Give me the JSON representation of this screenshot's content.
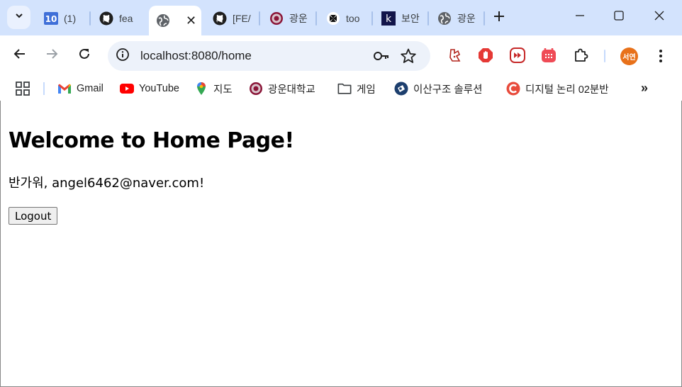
{
  "tabs": [
    {
      "label": "(1)",
      "icon": "tab-10-icon"
    },
    {
      "label": "fea",
      "icon": "github-icon"
    },
    {
      "label": "",
      "icon": "globe-icon",
      "active": true
    },
    {
      "label": "[FE/",
      "icon": "github-icon"
    },
    {
      "label": "광운",
      "icon": "kwu-emblem-icon"
    },
    {
      "label": "too",
      "icon": "tool-icon"
    },
    {
      "label": "보안",
      "icon": "k-icon"
    },
    {
      "label": "광운",
      "icon": "globe-icon"
    }
  ],
  "toolbar": {
    "url": "localhost:8080/home",
    "profile_label": "서연"
  },
  "bookmarks": [
    {
      "label": "Gmail",
      "icon": "gmail-icon"
    },
    {
      "label": "YouTube",
      "icon": "youtube-icon"
    },
    {
      "label": "지도",
      "icon": "maps-pin-icon"
    },
    {
      "label": "광운대학교",
      "icon": "kwu-emblem-icon"
    },
    {
      "label": "게임",
      "icon": "folder-icon"
    },
    {
      "label": "이산구조 솔루션",
      "icon": "discrete-icon"
    },
    {
      "label": "디지털 논리 02분반",
      "icon": "c-circle-icon"
    }
  ],
  "page": {
    "heading": "Welcome to Home Page!",
    "greeting": "반가워, angel6462@naver.com!",
    "logout_label": "Logout"
  },
  "colors": {
    "tabstrip_bg": "#d3e3fd",
    "omnibox_bg": "#edf2fa",
    "avatar_bg": "#e8711a",
    "youtube_red": "#ff0000",
    "gmail_red": "#ea4335"
  }
}
